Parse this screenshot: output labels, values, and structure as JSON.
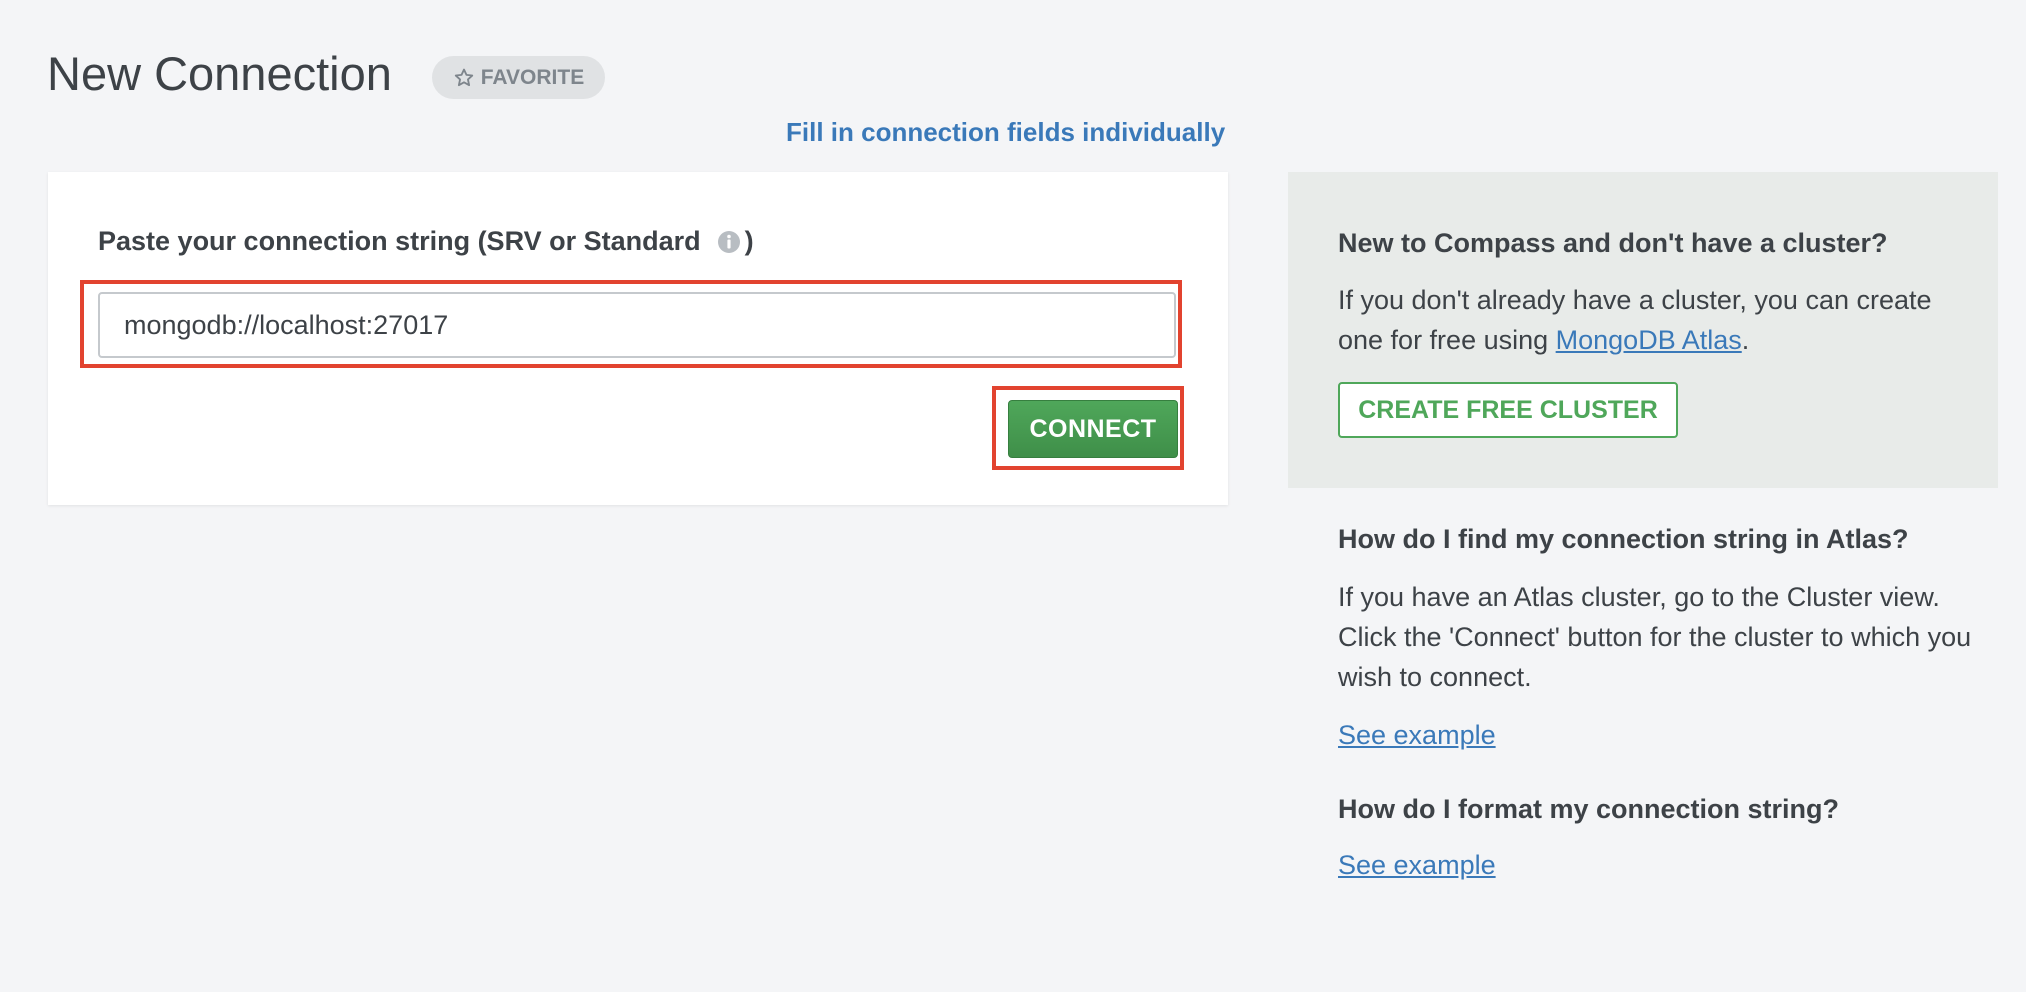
{
  "header": {
    "title": "New Connection",
    "favorite_label": "FAVORITE"
  },
  "fill_fields_link": "Fill in connection fields individually",
  "connection": {
    "label": "Paste your connection string (SRV or Standard",
    "label_close": ")",
    "value": "mongodb://localhost:27017",
    "connect_label": "CONNECT"
  },
  "promo": {
    "heading": "New to Compass and don't have a cluster?",
    "text_before": "If you don't already have a cluster, you can create one for free using ",
    "atlas_link": "MongoDB Atlas",
    "text_after": ".",
    "create_label": "CREATE FREE CLUSTER"
  },
  "help": {
    "q1": "How do I find my connection string in Atlas?",
    "a1": "If you have an Atlas cluster, go to the Cluster view. Click the 'Connect' button for the cluster to which you wish to connect.",
    "link1": "See example",
    "q2": "How do I format my connection string?",
    "link2": "See example"
  },
  "colors": {
    "accent_green": "#4fa75a",
    "link_blue": "#3a79b9",
    "highlight_red": "#e2432f"
  },
  "icons": {
    "favorite": "star-outline-icon",
    "info": "info-icon"
  }
}
